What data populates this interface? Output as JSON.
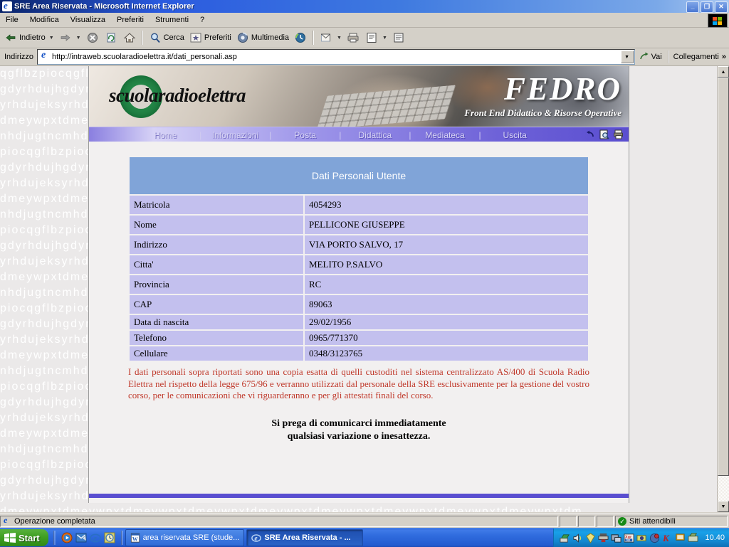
{
  "window": {
    "title": "SRE Area Riservata - Microsoft Internet Explorer",
    "icon": "ie-icon",
    "minimize": "_",
    "restore": "❐",
    "close": "✕"
  },
  "menubar": {
    "items": [
      {
        "label": "File",
        "name": "menu-file"
      },
      {
        "label": "Modifica",
        "name": "menu-modifica"
      },
      {
        "label": "Visualizza",
        "name": "menu-visualizza"
      },
      {
        "label": "Preferiti",
        "name": "menu-preferiti"
      },
      {
        "label": "Strumenti",
        "name": "menu-strumenti"
      },
      {
        "label": "?",
        "name": "menu-help"
      }
    ]
  },
  "toolbar": {
    "back": "Indietro",
    "forward": "",
    "stop": "",
    "refresh": "",
    "home": "",
    "search": "Cerca",
    "favorites": "Preferiti",
    "media": "Multimedia",
    "history": "",
    "mail": "",
    "print": "",
    "edit": "",
    "discuss": ""
  },
  "address": {
    "label": "Indirizzo",
    "url": "http://intraweb.scuolaradioelettra.it/dati_personali.asp",
    "go": "Vai",
    "links": "Collegamenti",
    "links_chevron": "»"
  },
  "banner": {
    "brand": "scuolaradioelettra",
    "product": "FEDRO",
    "tagline": "Front End Didattico & Risorse Operative"
  },
  "nav": {
    "items": [
      {
        "label": "Home",
        "name": "nav-home"
      },
      {
        "label": "Informazioni",
        "name": "nav-informazioni"
      },
      {
        "label": "Posta",
        "name": "nav-posta"
      },
      {
        "label": "Didattica",
        "name": "nav-didattica"
      },
      {
        "label": "Mediateca",
        "name": "nav-mediateca"
      },
      {
        "label": "Uscita",
        "name": "nav-uscita"
      }
    ],
    "separator": "|",
    "tools": [
      "undo-icon",
      "preview-icon",
      "print-icon"
    ]
  },
  "page": {
    "heading": "Dati Personali Utente",
    "rows": [
      {
        "label": "Matricola",
        "value": "4054293"
      },
      {
        "label": "Nome",
        "value": "PELLICONE GIUSEPPE"
      },
      {
        "label": "Indirizzo",
        "value": "VIA PORTO SALVO, 17"
      },
      {
        "label": "Citta'",
        "value": "MELITO P.SALVO"
      },
      {
        "label": "Provincia",
        "value": "RC"
      },
      {
        "label": "CAP",
        "value": "89063"
      },
      {
        "label": "Data di nascita",
        "value": "29/02/1956"
      },
      {
        "label": "Telefono",
        "value": "0965/771370"
      },
      {
        "label": "Cellulare",
        "value": "0348/3123765"
      }
    ],
    "disclaimer": "I dati personali sopra riportati sono una copia esatta di quelli custoditi nel sistema centralizzato AS/400 di Scuola Radio Elettra nel rispetto della legge 675/96 e verranno utilizzati dal personale della SRE esclusivamente per la gestione del vostro corso, per le comunicazioni che vi riguarderanno e per gli attestati finali del corso.",
    "note_line1": "Si prega di comunicarci immediatamente",
    "note_line2": "qualsiasi variazione o inesattezza."
  },
  "statusbar": {
    "message": "Operazione completata",
    "zone": "Siti attendibili",
    "zone_icon": "trusted-sites-icon"
  },
  "taskbar": {
    "start": "Start",
    "quicklaunch": [
      "media-player-icon",
      "outlook-express-icon",
      "internet-explorer-icon",
      "clock-icon"
    ],
    "items": [
      {
        "label": "area riservata SRE (stude...",
        "icon": "word-icon",
        "active": false
      },
      {
        "label": "SRE Area Riservata - ...",
        "icon": "ie-icon",
        "active": true
      }
    ],
    "clock": "10.40"
  },
  "wallpaper": {
    "lines": [
      "qgflbzpiocqgflbzpiocqgflbzpiocqgflbzpiocqgflbzpiocqgflbzpiocqgflbzpiocqgfl",
      "gdyrhdujhgdyrhdujhgdyrhdujhgdyrhdujhgdyrhdujhgdyrhdujhgdyrhdujhgdyrhdujhgd",
      "yrhdujeksyrhdujeksyrhdujeksyrhdujeksyrhdujeksyrhdujeksyrhdujeksyrhdujeksyr",
      "dmeywpxtdmeywpxtdmeywpxtdmeywpxtdmeywpxtdmeywpxtdmeywpxtdmeywpxtdmeywpxtdm",
      "nhdjugtncmhdjugtncmhdjugtncmhdjugtncmhdjugtncmhdjugtncmhdjugtncmhdjugtncmh",
      "piocqgflbzpiocqgflbzpiocqgflbzpiocqgflbzpiocqgflbzpiocqgflbzpiocqgflbzpioc",
      "gdyrhdujhgdyrhdujhgdyrhdujhgdyrhdujhgdyrhdujhgdyrhdujhgdyrhdujhgdyrhdujhgd",
      "yrhdujeksyrhdujeksyrhdujeksyrhdujeksyrhdujeksyrhdujeksyrhdujeksyrhdujeksyr",
      "dmeywpxtdmeywpxtdmeywpxtdmeywpxtdmeywpxtdmeywpxtdmeywpxtdmeywpxtdmeywpxtdm",
      "nhdjugtncmhdjugtncmhdjugtncmhdjugtncmhdjugtncmhdjugtncmhdjugtncmhdjugtncmh",
      "piocqgflbzpiocqgflbzpiocqgflbzpiocqgflbzpiocqgflbzpiocqgflbzpiocqgflbzpioc",
      "gdyrhdujhgdyrhdujhgdyrhdujhgdyrhdujhgdyrhdujhgdyrhdujhgdyrhdujhgdyrhdujhgd",
      "yrhdujeksyrhdujeksyrhdujeksyrhdujeksyrhdujeksyrhdujeksyrhdujeksyrhdujeksyr",
      "dmeywpxtdmeywpxtdmeywpxtdmeywpxtdmeywpxtdmeywpxtdmeywpxtdmeywpxtdmeywpxtdm",
      "nhdjugtncmhdjugtncmhdjugtncmhdjugtncmhdjugtncmhdjugtncmhdjugtncmhdjugtncmh",
      "piocqgflbzpiocqgflbzpiocqgflbzpiocqgflbzpiocqgflbzpiocqgflbzpiocqgflbzpioc",
      "gdyrhdujhgdyrhdujhgdyrhdujhgdyrhdujhgdyrhdujhgdyrhdujhgdyrhdujhgdyrhdujhgd",
      "yrhdujeksyrhdujeksyrhdujeksyrhdujeksyrhdujeksyrhdujeksyrhdujeksyrhdujeksyr",
      "dmeywpxtdmeywpxtdmeywpxtdmeywpxtdmeywpxtdmeywpxtdmeywpxtdmeywpxtdmeywpxtdm",
      "nhdjugtncmhdjugtncmhdjugtncmhdjugtncmhdjugtncmhdjugtncmhdjugtncmhdjugtncmh",
      "piocqgflbzpiocqgflbzpiocqgflbzpiocqgflbzpiocqgflbzpiocqgflbzpiocqgflbzpioc",
      "gdyrhdujhgdyrhdujhgdyrhdujhgdyrhdujhgdyrhdujhgdyrhdujhgdyrhdujhgdyrhdujhgd",
      "yrhdujeksyrhdujeksyrhdujeksyrhdujeksyrhdujeksyrhdujeksyrhdujeksyrhdujeksyr",
      "dmeywpxtdmeywpxtdmeywpxtdmeywpxtdmeywpxtdmeywpxtdmeywpxtdmeywpxtdmeywpxtdm",
      "nhdjugtncmhdjugtncmhdjugtncmhdjugtncmhdjugtncmhdjugtncmhdjugtncmhdjugtncmh",
      "piocqgflbzpiocqgflbzpiocqgflbzpiocqgflbzpiocqgflbzpiocqgflbzpiocqgflbzpioc",
      "gdyrhdujhgdyrhdujhgdyrhdujhgdyrhdujhgdyrhdujhgdyrhdujhgdyrhdujhgdyrhdujhgd",
      "yrhdujeksyrhdujeksyrhdujeksyrhdujeksyrhdujeksyrhdujeksyrhdujeksyrhdujeksyr",
      "dmeywpxtdmeywpxtdmeywpxtdmeywpxtdmeywpxtdmeywpxtdmeywpxtdmeywpxtdmeywpxtdm"
    ]
  },
  "colors": {
    "table_header": "#80a4d8",
    "table_cell": "#c3c0ee",
    "nav_bar": "#8a7fe0",
    "disclaimer_text": "#c0392b",
    "titlebar": "#0a246a"
  }
}
